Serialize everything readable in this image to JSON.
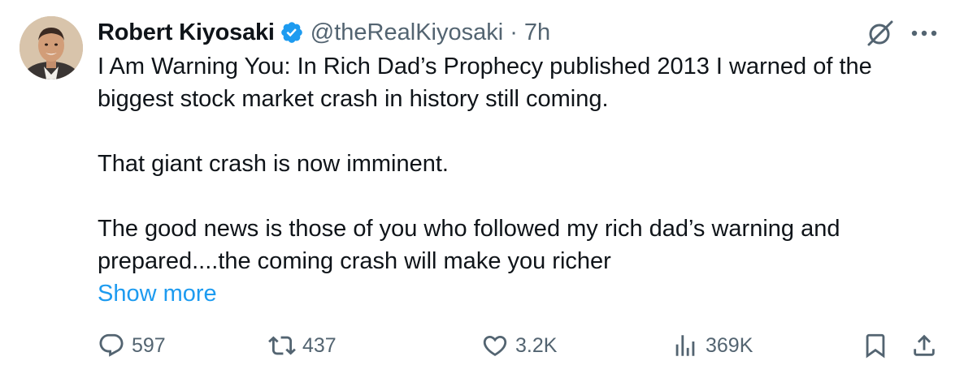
{
  "author": {
    "display_name": "Robert Kiyosaki",
    "handle": "@theRealKiyosaki",
    "separator": "·",
    "time": "7h",
    "verified": true,
    "avatar_icon": "avatar-photo"
  },
  "tweet": {
    "paragraph_1": "I Am Warning You:  In Rich Dad’s Prophecy published 2013 I warned of the biggest stock market crash in history still coming.",
    "paragraph_2": "That giant crash is now imminent.",
    "paragraph_3": "The good news is those of you who followed my rich dad’s warning and prepared....the coming crash will make you richer",
    "show_more": "Show more"
  },
  "actions": {
    "replies": "597",
    "reposts": "437",
    "likes": "3.2K",
    "views": "369K",
    "icons": [
      "reply-icon",
      "repost-icon",
      "like-icon",
      "views-icon",
      "bookmark-icon",
      "share-icon"
    ]
  },
  "colors": {
    "text": "#0f1419",
    "secondary": "#536471",
    "link": "#1d9bf0",
    "verified": "#1d9bf0"
  }
}
